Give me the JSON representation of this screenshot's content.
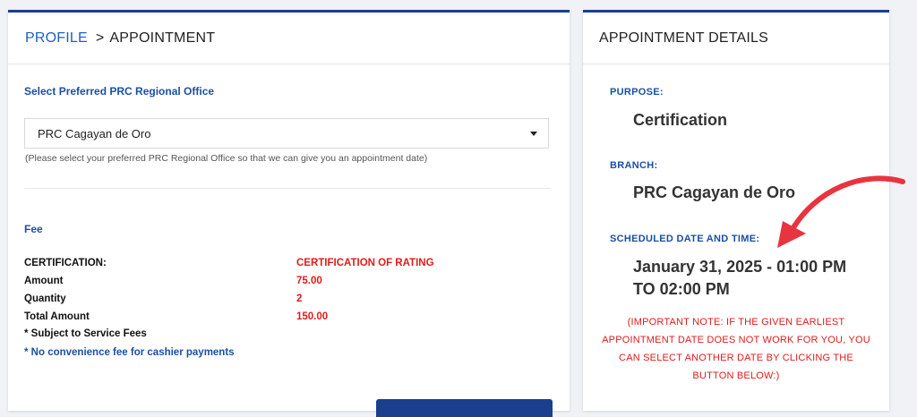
{
  "breadcrumb": {
    "profile": "PROFILE",
    "separator": ">",
    "current": "APPOINTMENT"
  },
  "office": {
    "label": "Select Preferred PRC Regional Office",
    "selected": "PRC Cagayan de Oro",
    "helper": "(Please select your preferred PRC Regional Office so that we can give you an appointment date)"
  },
  "fee": {
    "title": "Fee",
    "rows": [
      {
        "label": "CERTIFICATION:",
        "value": "CERTIFICATION OF RATING"
      },
      {
        "label": "Amount",
        "value": "75.00"
      },
      {
        "label": "Quantity",
        "value": "2"
      },
      {
        "label": "Total Amount",
        "value": "150.00"
      }
    ],
    "note_service": "* Subject to Service Fees",
    "note_cashier": "* No convenience fee for cashier payments"
  },
  "details": {
    "title": "APPOINTMENT DETAILS",
    "purpose_label": "PURPOSE:",
    "purpose": "Certification",
    "branch_label": "BRANCH:",
    "branch": "PRC Cagayan de Oro",
    "schedule_label": "SCHEDULED DATE AND TIME:",
    "schedule": "January 31, 2025 - 01:00 PM TO 02:00 PM",
    "important_note": "(IMPORTANT NOTE: IF THE GIVEN EARLIEST APPOINTMENT DATE DOES NOT WORK FOR YOU, YOU CAN SELECT ANOTHER DATE BY CLICKING THE BUTTON BELOW:)"
  },
  "colors": {
    "accent": "#1a3f8f",
    "link": "#1f5fbf",
    "alert": "#e31b1b",
    "arrow": "#e8343f"
  }
}
